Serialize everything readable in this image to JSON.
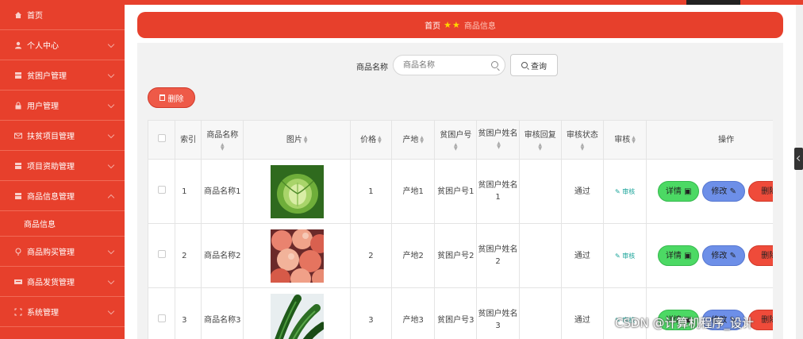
{
  "sidebar": {
    "items": [
      {
        "label": "首页",
        "icon": "home-icon"
      },
      {
        "label": "个人中心",
        "icon": "user-icon"
      },
      {
        "label": "贫困户管理",
        "icon": "grid-icon"
      },
      {
        "label": "用户管理",
        "icon": "lock-icon"
      },
      {
        "label": "扶贫项目管理",
        "icon": "mail-icon"
      },
      {
        "label": "项目资助管理",
        "icon": "grid-icon"
      },
      {
        "label": "商品信息管理",
        "icon": "grid-icon"
      },
      {
        "label": "商品信息",
        "icon": ""
      },
      {
        "label": "商品购买管理",
        "icon": "pin-icon"
      },
      {
        "label": "商品发货管理",
        "icon": "list-icon"
      },
      {
        "label": "系统管理",
        "icon": "expand-icon"
      }
    ]
  },
  "breadcrumb": {
    "home": "首页",
    "stars": "★★",
    "current": "商品信息"
  },
  "search": {
    "label": "商品名称",
    "placeholder": "商品名称",
    "button": "查询"
  },
  "toolbar": {
    "delete_label": "删除"
  },
  "table": {
    "headers": {
      "index": "索引",
      "name": "商品名称",
      "image": "图片",
      "price": "价格",
      "origin": "产地",
      "household_no": "贫困户号",
      "household_name": "贫困户姓名",
      "audit_reply": "审核回复",
      "audit_status": "审核状态",
      "audit": "审核",
      "actions": "操作"
    },
    "rows": [
      {
        "index": "1",
        "name": "商品名称1",
        "price": "1",
        "origin": "产地1",
        "household_no": "贫困户号1",
        "household_name": "贫困户姓名1",
        "audit_reply": "",
        "audit_status": "通过",
        "audit_link": "审核",
        "image": "cabbage"
      },
      {
        "index": "2",
        "name": "商品名称2",
        "price": "2",
        "origin": "产地2",
        "household_no": "贫困户号2",
        "household_name": "贫困户姓名2",
        "audit_reply": "",
        "audit_status": "通过",
        "audit_link": "审核",
        "image": "peaches"
      },
      {
        "index": "3",
        "name": "商品名称3",
        "price": "3",
        "origin": "产地3",
        "household_no": "贫困户号3",
        "household_name": "贫困户姓名3",
        "audit_reply": "",
        "audit_status": "通过",
        "audit_link": "审核",
        "image": "cucumbers"
      }
    ],
    "row_actions": {
      "detail": "详情",
      "edit": "修改",
      "delete": "删除"
    }
  },
  "watermark": "CSDN @计算机程序_设计",
  "colors": {
    "accent": "#e7402c",
    "detail": "#4cd964",
    "edit": "#6d8fe8",
    "delete": "#ef4b3a",
    "link": "#17a398"
  }
}
